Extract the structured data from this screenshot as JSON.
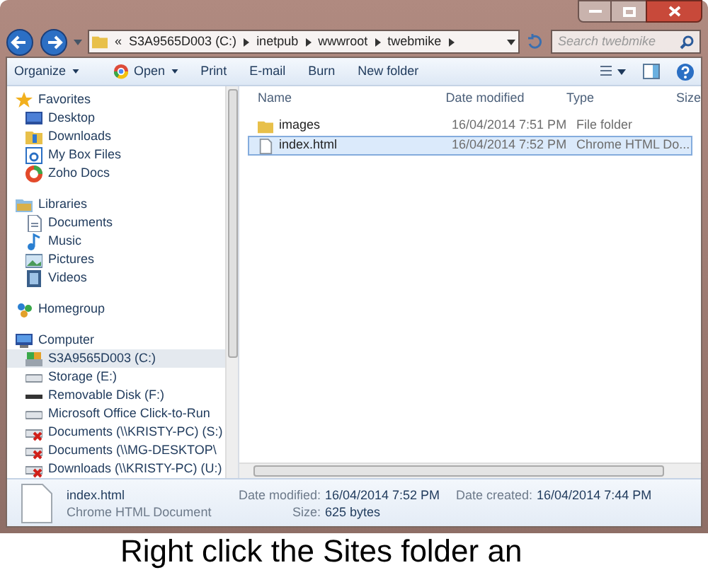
{
  "address_bar": {
    "overflow": "«",
    "crumbs": [
      "S3A9565D003 (C:)",
      "inetpub",
      "wwwroot",
      "twebmike"
    ]
  },
  "search": {
    "placeholder": "Search twebmike"
  },
  "toolbar": [
    {
      "label": "Organize",
      "kind": "menu"
    },
    {
      "label": "Open",
      "kind": "open"
    },
    {
      "label": "Print",
      "kind": "button"
    },
    {
      "label": "E-mail",
      "kind": "button"
    },
    {
      "label": "Burn",
      "kind": "button"
    },
    {
      "label": "New folder",
      "kind": "button"
    }
  ],
  "sidebar": {
    "groups": [
      {
        "label": "Favorites",
        "kind": "star",
        "children": [
          {
            "label": "Desktop",
            "kind": "desktop",
            "selected": false
          },
          {
            "label": "Downloads",
            "kind": "downloads",
            "selected": false
          },
          {
            "label": "My Box Files",
            "kind": "box",
            "selected": false
          },
          {
            "label": "Zoho Docs",
            "kind": "zoho",
            "selected": false
          }
        ]
      },
      {
        "label": "Libraries",
        "kind": "libraries",
        "children": [
          {
            "label": "Documents",
            "kind": "documents",
            "selected": false
          },
          {
            "label": "Music",
            "kind": "music",
            "selected": false
          },
          {
            "label": "Pictures",
            "kind": "pictures",
            "selected": false
          },
          {
            "label": "Videos",
            "kind": "videos",
            "selected": false
          }
        ]
      },
      {
        "label": "Homegroup",
        "kind": "homegroup"
      },
      {
        "label": "Computer",
        "kind": "computer",
        "children": [
          {
            "label": "S3A9565D003 (C:)",
            "kind": "system",
            "selected": true
          },
          {
            "label": "Storage (E:)",
            "kind": "drive",
            "selected": false
          },
          {
            "label": "Removable Disk (F:)",
            "kind": "removable",
            "selected": false
          },
          {
            "label": "Microsoft Office Click-to-Run",
            "kind": "drive",
            "selected": false
          },
          {
            "label": "Documents (\\\\KRISTY-PC) (S:)",
            "kind": "network",
            "selected": false
          },
          {
            "label": "Documents (\\\\MG-DESKTOP\\",
            "kind": "network",
            "selected": false
          },
          {
            "label": "Downloads (\\\\KRISTY-PC) (U:)",
            "kind": "network",
            "selected": false
          }
        ]
      }
    ]
  },
  "files": {
    "columns": [
      "Name",
      "Date modified",
      "Type",
      "Size"
    ],
    "rows": [
      {
        "name": "images",
        "date": "16/04/2014 7:51 PM",
        "type": "File folder",
        "kind": "folder",
        "selected": false
      },
      {
        "name": "index.html",
        "date": "16/04/2014 7:52 PM",
        "type": "Chrome HTML Do...",
        "kind": "file",
        "selected": true
      }
    ]
  },
  "details": {
    "name": "index.html",
    "type": "Chrome HTML Document",
    "modified_label": "Date modified:",
    "modified": "16/04/2014 7:52 PM",
    "size_label": "Size:",
    "size": "625 bytes",
    "created_label": "Date created:",
    "created": "16/04/2014 7:44 PM"
  },
  "caption": "Right click the Sites folder an"
}
